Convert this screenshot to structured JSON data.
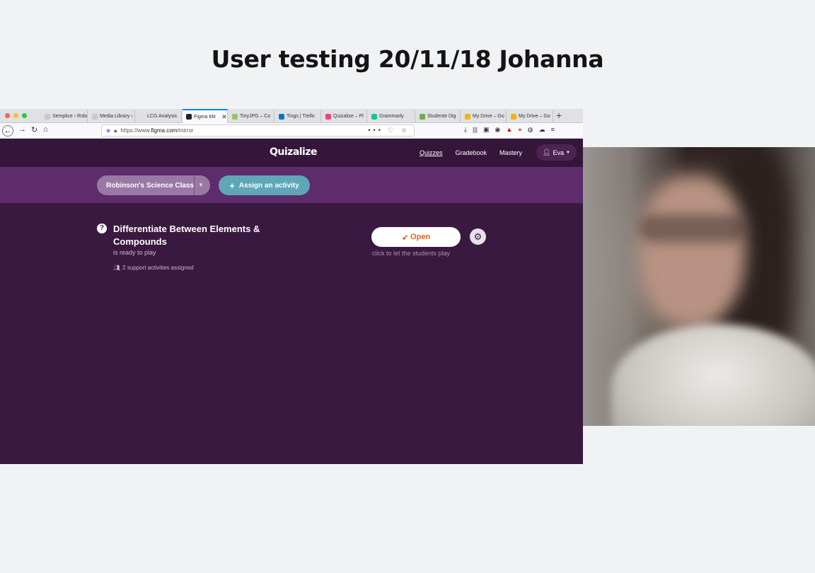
{
  "slide": {
    "title": "User testing 20/11/18 Johanna"
  },
  "browser": {
    "tabs": [
      {
        "label": "Semplice ‹ Rober",
        "color": "#c8c8c8"
      },
      {
        "label": "Media Library ‹ Ro",
        "color": "#c8c8c8"
      },
      {
        "label": "LCG Analysis",
        "color": "#e0e0e0"
      },
      {
        "label": "Figma Mir",
        "color": "#222222",
        "active": true
      },
      {
        "label": "TinyJPG – Co",
        "color": "#9cc36e"
      },
      {
        "label": "Tings | Trello",
        "color": "#0079bf"
      },
      {
        "label": "Quizalize – Pl",
        "color": "#e4477b"
      },
      {
        "label": "Grammarly",
        "color": "#15c39a"
      },
      {
        "label": "Studente Dig",
        "color": "#6ab04c"
      },
      {
        "label": "My Drive – Go",
        "color": "#f4b400"
      },
      {
        "label": "My Drive – Go",
        "color": "#f4b400"
      }
    ],
    "url_prefix": "https://www.",
    "url_domain": "figma.com",
    "url_path": "/mirror",
    "url_actions": "••• ♡ ☆"
  },
  "app": {
    "logo": "Quizalize",
    "nav": {
      "quizzes": "Quizzes",
      "gradebook": "Gradebook",
      "mastery": "Mastery"
    },
    "user": "Eva",
    "class_name": "Robinson's Science Class",
    "assign_label": "Assign an activity",
    "activity": {
      "title": "Differentiate Between Elements & Compounds",
      "status": "is ready to play",
      "support": "2 support activities assigned",
      "open_label": "Open",
      "open_hint": "click to let the students play"
    }
  },
  "colors": {
    "app_bg": "#3a1941",
    "class_bar": "#5e2c6a",
    "assign": "#5fa6b6",
    "open_text": "#f0581f"
  }
}
